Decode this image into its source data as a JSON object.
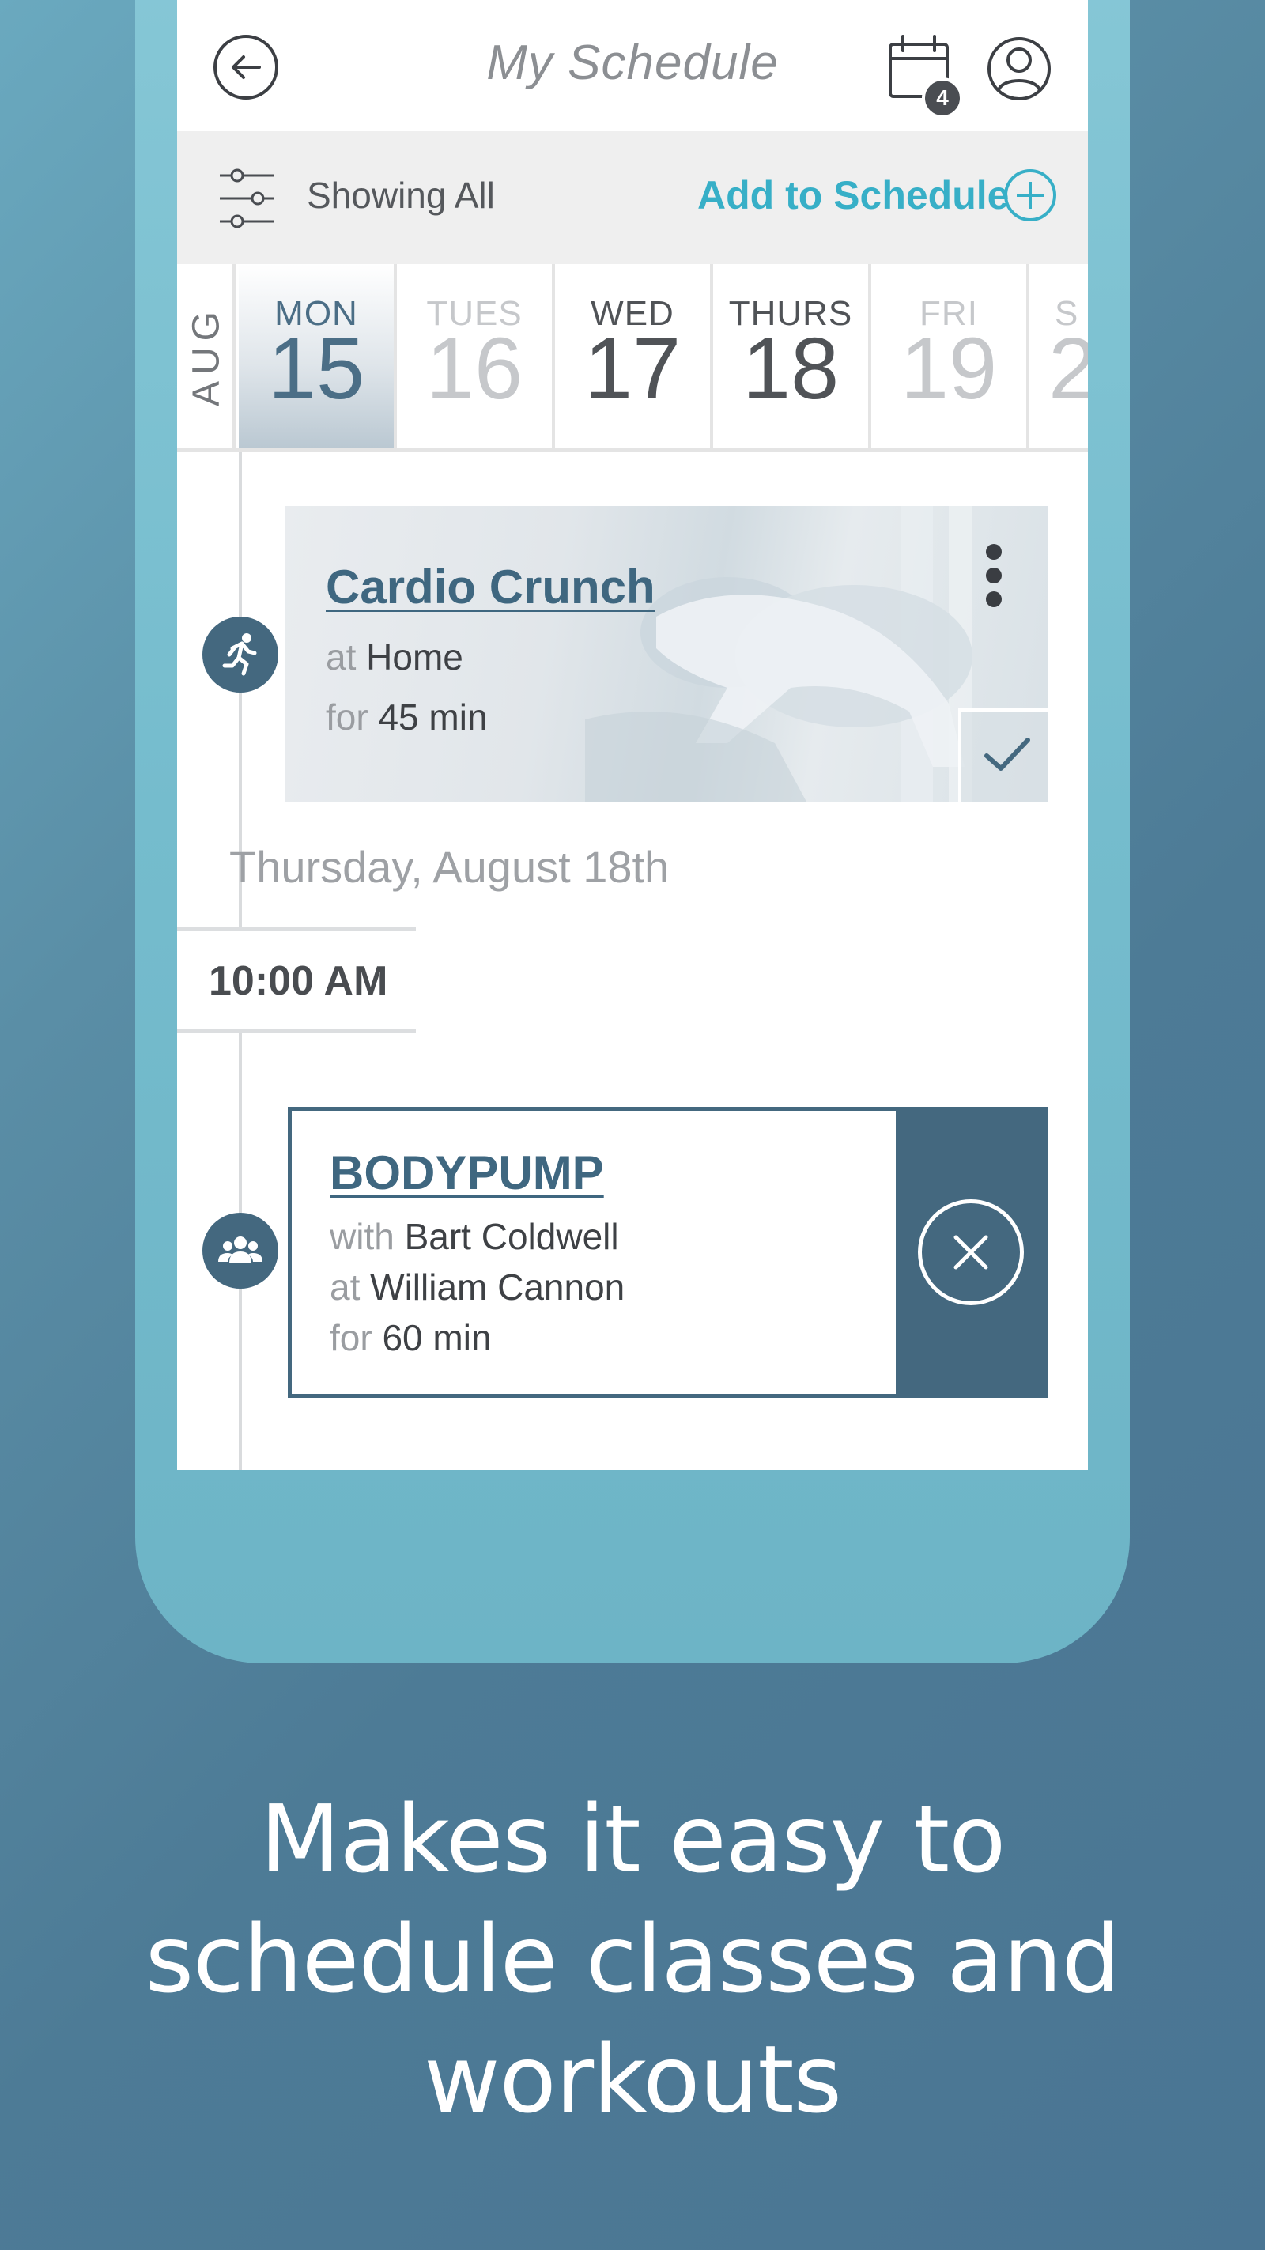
{
  "header": {
    "title": "My Schedule",
    "calendar_badge": "4"
  },
  "filter": {
    "showing_label": "Showing All",
    "add_label": "Add to Schedule"
  },
  "date_strip": {
    "month": "AUG",
    "days": [
      {
        "name": "MON",
        "num": "15",
        "state": "selected"
      },
      {
        "name": "TUES",
        "num": "16",
        "state": "dim"
      },
      {
        "name": "WED",
        "num": "17",
        "state": "dark"
      },
      {
        "name": "THURS",
        "num": "18",
        "state": "dark"
      },
      {
        "name": "FRI",
        "num": "19",
        "state": "dim"
      },
      {
        "name": "S",
        "num": "2",
        "state": "dim"
      }
    ]
  },
  "events": [
    {
      "title": "Cardio Crunch",
      "at_prefix": "at",
      "location": "Home",
      "for_prefix": "for",
      "duration": "45 min",
      "icon": "running-person-icon",
      "completed": true
    },
    {
      "title": "BODYPUMP",
      "with_prefix": "with",
      "instructor": "Bart Coldwell",
      "at_prefix": "at",
      "location": "William Cannon",
      "for_prefix": "for",
      "duration": "60 min",
      "icon": "group-icon"
    }
  ],
  "section_date": "Thursday, August 18th",
  "time_slot": "10:00 AM",
  "tagline": [
    "Makes it easy to",
    "schedule classes and",
    "workouts"
  ],
  "colors": {
    "accent": "#37afc7",
    "primary_dark": "#44687f",
    "phone_frame": "#75bccd",
    "background": "#4d7b96"
  }
}
